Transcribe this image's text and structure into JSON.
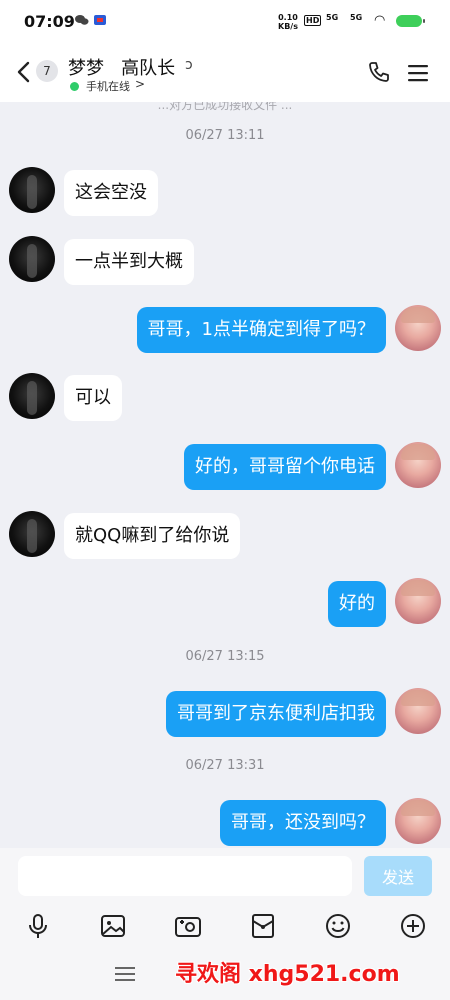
{
  "status_bar": {
    "time": "07:09",
    "net_speed_value": "0.10",
    "net_speed_unit": "KB/s",
    "hd_label": "HD",
    "signal1_label": "5G",
    "signal2_label": "5G",
    "battery_color": "#3ecf5a"
  },
  "header": {
    "unread_count": "7",
    "contact_name": "梦梦   高队长",
    "online_status": "手机在线",
    "online_chevron": ">",
    "icons": [
      "back-icon",
      "ear-icon",
      "phone-icon",
      "menu-icon"
    ]
  },
  "chat": {
    "ghost_text": "...对方已成功接收文件 ...",
    "timestamps": [
      "06/27 13:11",
      "06/27 13:15",
      "06/27 13:31"
    ],
    "messages": [
      {
        "side": "in",
        "text": "这会空没"
      },
      {
        "side": "in",
        "text": "一点半到大概"
      },
      {
        "side": "out",
        "text": "哥哥，1点半确定到得了吗？"
      },
      {
        "side": "in",
        "text": "可以"
      },
      {
        "side": "out",
        "text": "好的，哥哥留个你电话"
      },
      {
        "side": "in",
        "text": "就QQ嘛到了给你说"
      },
      {
        "side": "out",
        "text": "好的"
      },
      {
        "side": "out",
        "text": "哥哥到了京东便利店扣我"
      },
      {
        "side": "out",
        "text": "哥哥，还没到吗？"
      }
    ],
    "outgoing_bubble_color": "#1aa0f5",
    "incoming_bubble_color": "#ffffff"
  },
  "input_bar": {
    "value": "",
    "placeholder": "",
    "send_label": "发送"
  },
  "toolbar": {
    "icons": [
      "microphone-icon",
      "photo-icon",
      "camera-icon",
      "red-packet-icon",
      "emoji-icon",
      "plus-icon"
    ]
  },
  "watermark": {
    "text": "寻欢阁 xhg521.com"
  }
}
